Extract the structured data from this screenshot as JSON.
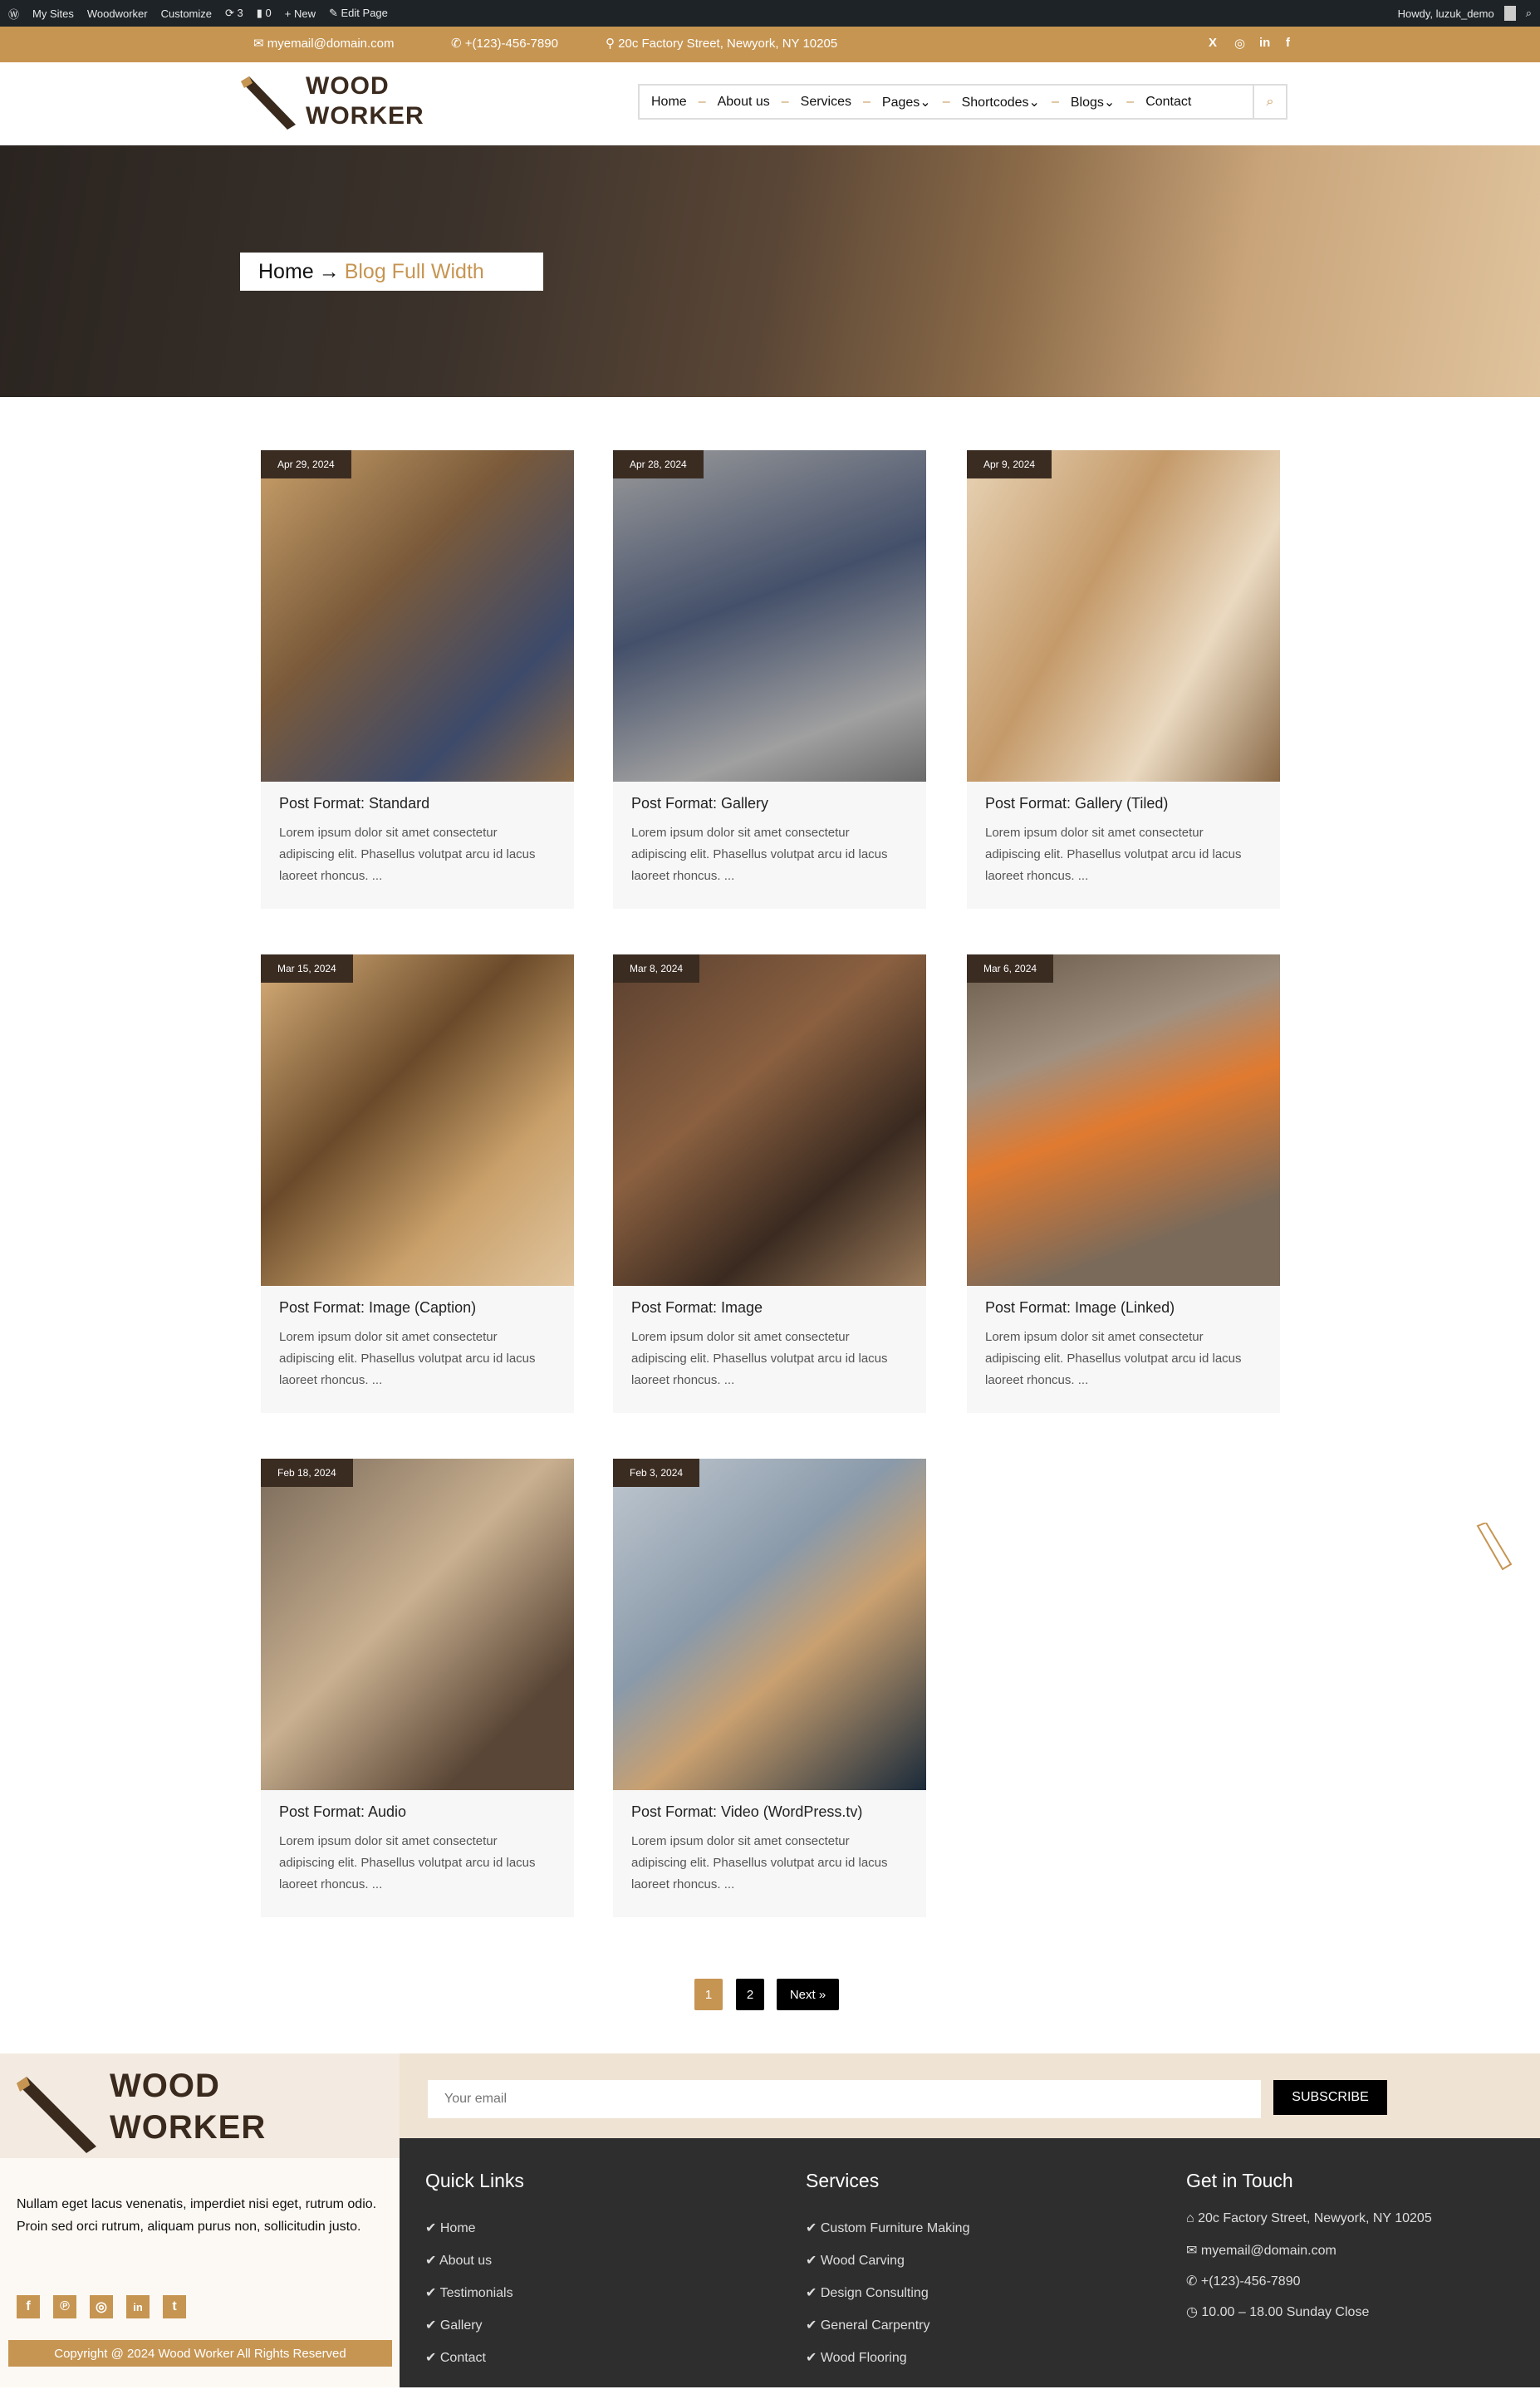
{
  "admin_bar": {
    "items": [
      "My Sites",
      "Woodworker",
      "Customize",
      "3",
      "0",
      "New",
      "Edit Page"
    ],
    "greeting": "Howdy, luzuk_demo"
  },
  "top_bar": {
    "email": "myemail@domain.com",
    "phone": "+(123)-456-7890",
    "address": "20c Factory Street, Newyork, NY 10205",
    "social": [
      "x-icon",
      "instagram-icon",
      "linkedin-icon",
      "facebook-icon"
    ]
  },
  "logo": {
    "line1": "WOOD",
    "line2": "WORKER"
  },
  "nav": {
    "items": [
      "Home",
      "About us",
      "Services",
      "Pages",
      "Shortcodes",
      "Blogs",
      "Contact"
    ]
  },
  "breadcrumb": {
    "home": "Home",
    "arrow": "→",
    "current": "Blog Full Width"
  },
  "posts": [
    {
      "date": "Apr 29, 2024",
      "title": "Post Format: Standard",
      "excerpt": "Lorem ipsum dolor sit amet consectetur adipiscing elit. Phasellus volutpat arcu id lacus laoreet rhoncus. ..."
    },
    {
      "date": "Apr 28, 2024",
      "title": "Post Format: Gallery",
      "excerpt": "Lorem ipsum dolor sit amet consectetur adipiscing elit. Phasellus volutpat arcu id lacus laoreet rhoncus. ..."
    },
    {
      "date": "Apr 9, 2024",
      "title": "Post Format: Gallery (Tiled)",
      "excerpt": "Lorem ipsum dolor sit amet consectetur adipiscing elit. Phasellus volutpat arcu id lacus laoreet rhoncus. ..."
    },
    {
      "date": "Mar 15, 2024",
      "title": "Post Format: Image (Caption)",
      "excerpt": "Lorem ipsum dolor sit amet consectetur adipiscing elit. Phasellus volutpat arcu id lacus laoreet rhoncus. ..."
    },
    {
      "date": "Mar 8, 2024",
      "title": "Post Format: Image",
      "excerpt": "Lorem ipsum dolor sit amet consectetur adipiscing elit. Phasellus volutpat arcu id lacus laoreet rhoncus. ..."
    },
    {
      "date": "Mar 6, 2024",
      "title": "Post Format: Image (Linked)",
      "excerpt": "Lorem ipsum dolor sit amet consectetur adipiscing elit. Phasellus volutpat arcu id lacus laoreet rhoncus. ..."
    },
    {
      "date": "Feb 18, 2024",
      "title": "Post Format: Audio",
      "excerpt": "Lorem ipsum dolor sit amet consectetur adipiscing elit. Phasellus volutpat arcu id lacus laoreet rhoncus. ..."
    },
    {
      "date": "Feb 3, 2024",
      "title": "Post Format: Video (WordPress.tv)",
      "excerpt": "Lorem ipsum dolor sit amet consectetur adipiscing elit. Phasellus volutpat arcu id lacus laoreet rhoncus. ..."
    }
  ],
  "pagination": {
    "current": "1",
    "page2": "2",
    "next": "Next »"
  },
  "footer": {
    "about": "Nullam eget lacus venenatis, imperdiet nisi eget, rutrum odio. Proin sed orci rutrum, aliquam purus non, sollicitudin justo.",
    "social": [
      "facebook-icon",
      "pinterest-icon",
      "instagram-icon",
      "linkedin-icon",
      "twitter-icon"
    ],
    "copyright": "Copyright @ 2024 Wood Worker All Rights Reserved",
    "email_placeholder": "Your email",
    "subscribe": "SUBSCRIBE",
    "quick_links_title": "Quick Links",
    "quick_links": [
      "Home",
      "About us",
      "Testimonials",
      "Gallery",
      "Contact"
    ],
    "services_title": "Services",
    "services": [
      "Custom Furniture Making",
      "Wood Carving",
      "Design Consulting",
      "General Carpentry",
      "Wood Flooring"
    ],
    "contact_title": "Get in Touch",
    "contact": [
      "20c Factory Street, Newyork, NY 10205",
      "myemail@domain.com",
      "+(123)-456-7890",
      "10.00 – 18.00 Sunday Close"
    ]
  },
  "colors": {
    "accent": "#c69552",
    "dark": "#2e2e2e",
    "brown": "#3a2a1e"
  }
}
